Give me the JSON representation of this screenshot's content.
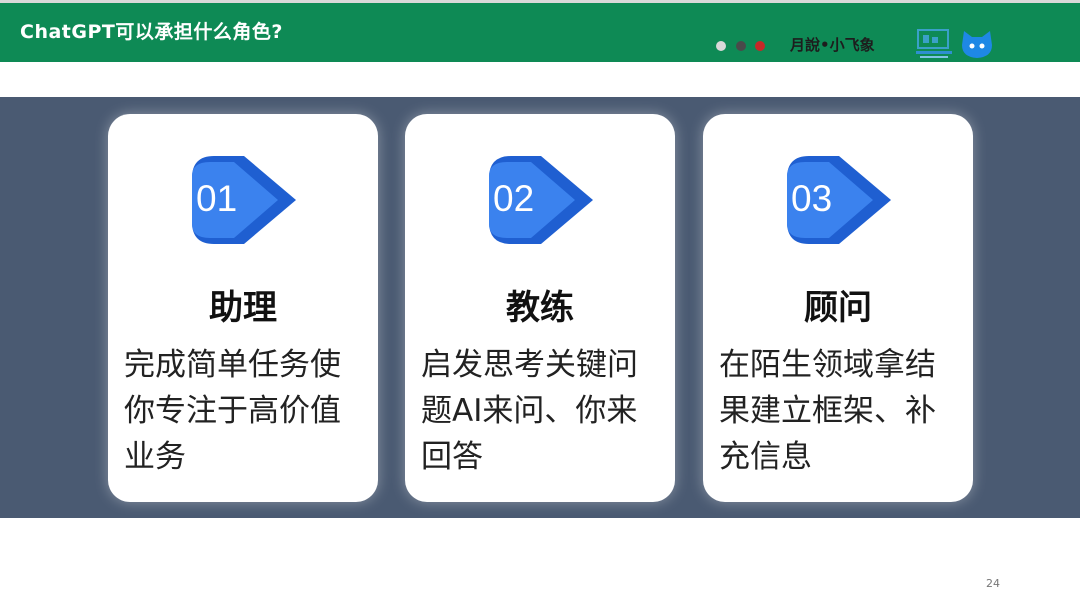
{
  "header": {
    "title": "ChatGPT可以承担什么角色?",
    "brand": "月說•小飞象",
    "bg_color": "#0e8a55",
    "dots": [
      "#d9d9d9",
      "#4a4a4a",
      "#c62828"
    ]
  },
  "cards": [
    {
      "number": "01",
      "title": "助理",
      "description": "完成简单任务使你专注于高价值业务"
    },
    {
      "number": "02",
      "title": "教练",
      "description": "启发思考关键问题AI来问、你来回答"
    },
    {
      "number": "03",
      "title": "顾问",
      "description": "在陌生领域拿结果建立框架、补充信息"
    }
  ],
  "colors": {
    "band": "#4a5a72",
    "badge_dark": "#1f5fd1",
    "badge_light": "#3b82ee"
  },
  "icons": {
    "logo": "classroom-logo-icon",
    "badge": "play-arrow-badge-icon"
  },
  "page_number": "24"
}
